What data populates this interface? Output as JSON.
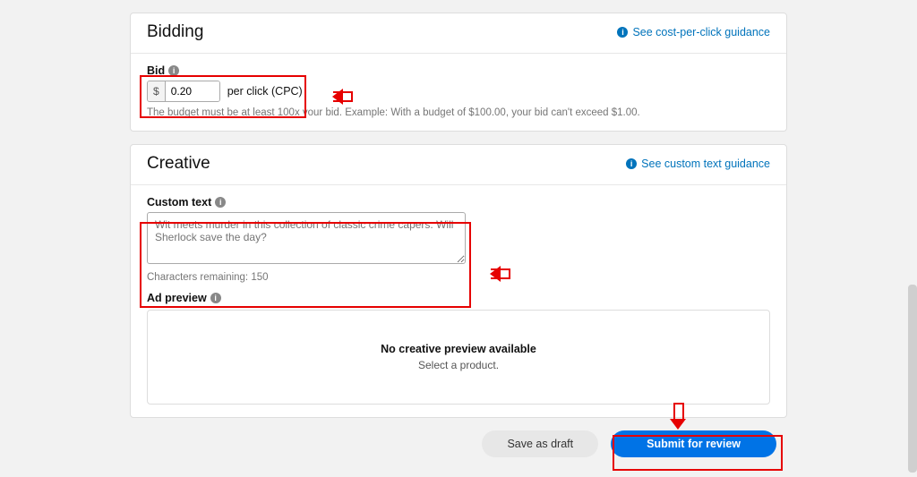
{
  "bidding": {
    "title": "Bidding",
    "help_link": "See cost-per-click guidance",
    "bid_label": "Bid",
    "currency": "$",
    "bid_value": "0.20",
    "suffix": "per click (CPC)",
    "helper": "The budget must be at least 100x your bid. Example: With a budget of $100.00, your bid can't exceed $1.00."
  },
  "creative": {
    "title": "Creative",
    "help_link": "See custom text guidance",
    "custom_text_label": "Custom text",
    "custom_text_placeholder": "Wit meets murder in this collection of classic crime capers. Will Sherlock save the day?",
    "chars_remaining": "Characters remaining: 150",
    "ad_preview_label": "Ad preview",
    "no_preview_title": "No creative preview available",
    "no_preview_sub": "Select a product."
  },
  "footer": {
    "save_draft": "Save as draft",
    "submit": "Submit for review"
  }
}
